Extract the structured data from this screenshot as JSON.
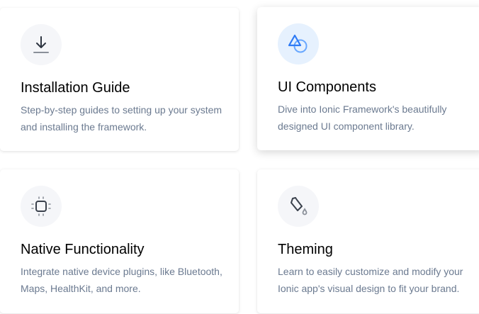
{
  "cards": [
    {
      "title": "Installation Guide",
      "description": "Step-by-step guides to setting up your system and installing the framework.",
      "icon": "download-icon"
    },
    {
      "title": "UI Components",
      "description": "Dive into Ionic Framework's beautifully designed UI component library.",
      "icon": "shapes-icon"
    },
    {
      "title": "Native Functionality",
      "description": "Integrate native device plugins, like Bluetooth, Maps, HealthKit, and more.",
      "icon": "chip-icon"
    },
    {
      "title": "Theming",
      "description": "Learn to easily customize and modify your Ionic app's visual design to fit your brand.",
      "icon": "paint-bucket-icon"
    }
  ],
  "colors": {
    "accent": "#3880ff",
    "icon_dark": "#374151",
    "text_muted": "#6b7a90"
  }
}
